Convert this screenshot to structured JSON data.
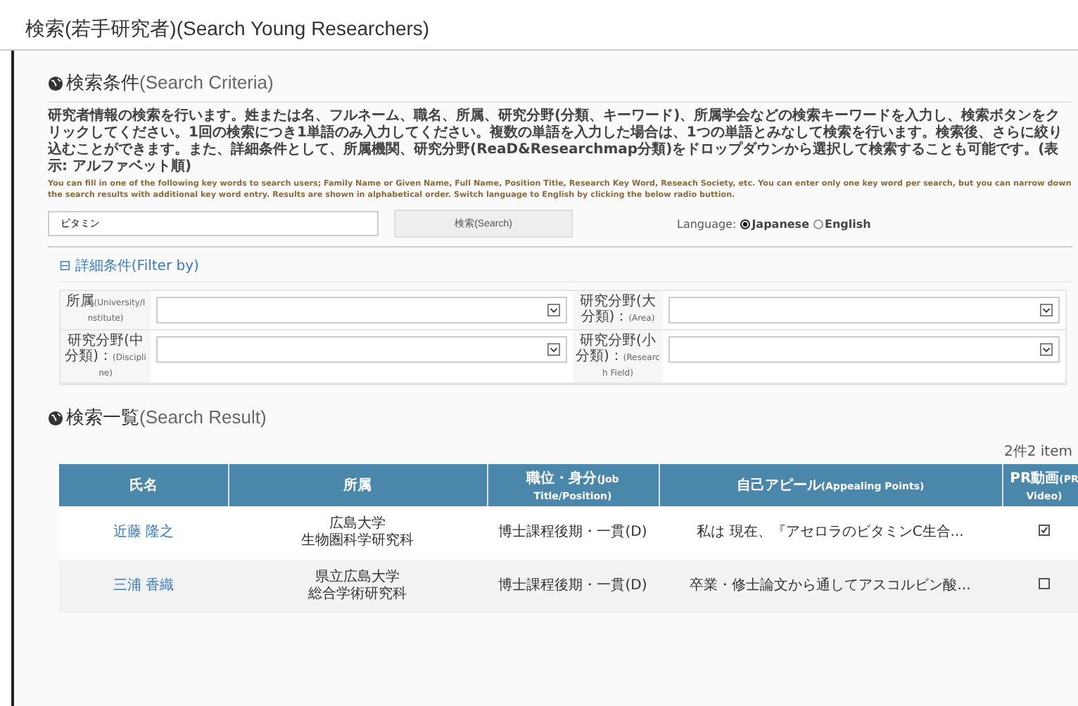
{
  "page_title": "検索(若手研究者)(Search Young Researchers)",
  "criteria": {
    "heading": "検索条件",
    "heading_en": "(Search Criteria)",
    "description_ja": "研究者情報の検索を行います。姓または名、フルネーム、職名、所属、研究分野(分類、キーワード)、所属学会などの検索キーワードを入力し、検索ボタンをクリックしてください。1回の検索につき1単語のみ入力してください。複数の単語を入力した場合は、1つの単語とみなして検索を行います。検索後、さらに絞り込むことができます。また、詳細条件として、所属機関、研究分野(ReaD&Researchmap分類)をドロップダウンから選択して検索することも可能です。(表示: アルファベット順)",
    "description_en": "You can fill in one of the following key words to search users; Family Name or Given Name, Full Name, Position Title, Research Key Word, Reseach Society, etc. You can enter only one key word per search, but you can narrow down the search results with additional key word entry. Results are shown in alphabetical order. Switch language to English by clicking the below radio buttion.",
    "search_value": "ビタミン",
    "search_button": "検索(Search)",
    "language_label": "Language:",
    "languages": [
      {
        "label": "Japanese",
        "selected": true
      },
      {
        "label": "English",
        "selected": false
      }
    ]
  },
  "filter": {
    "toggle": "⊟",
    "heading": "詳細条件",
    "heading_en": "(Filter by)",
    "fields": [
      {
        "label_ja": "所属",
        "label_en": "(University/Institute)"
      },
      {
        "label_ja": "研究分野(大分類)：",
        "label_en": "(Area)"
      },
      {
        "label_ja": "研究分野(中分類)：",
        "label_en": "(Discipline)"
      },
      {
        "label_ja": "研究分野(小分類)：",
        "label_en": "(Research Field)"
      }
    ]
  },
  "results": {
    "heading": "検索一覧",
    "heading_en": "(Search Result)",
    "count": "2件2 item",
    "columns": [
      {
        "ja": "氏名"
      },
      {
        "ja": "所属"
      },
      {
        "ja": "職位・身分",
        "en": "(Job Title/Position)"
      },
      {
        "ja": "自己アピール",
        "en": "(Appealing Points)"
      },
      {
        "ja": "PR動画",
        "en": "(PR Video)"
      }
    ],
    "rows": [
      {
        "name": "近藤 隆之",
        "affiliation": [
          "広島大学",
          "生物圏科学研究科"
        ],
        "position": "博士課程後期・一貫(D)",
        "appeal": "私は 現在、『アセロラのビタミンC生合...",
        "video": true
      },
      {
        "name": "三浦 香織",
        "affiliation": [
          "県立広島大学",
          "総合学術研究科"
        ],
        "position": "博士課程後期・一貫(D)",
        "appeal": "卒業・修士論文から通してアスコルビン酸...",
        "video": false
      }
    ]
  }
}
